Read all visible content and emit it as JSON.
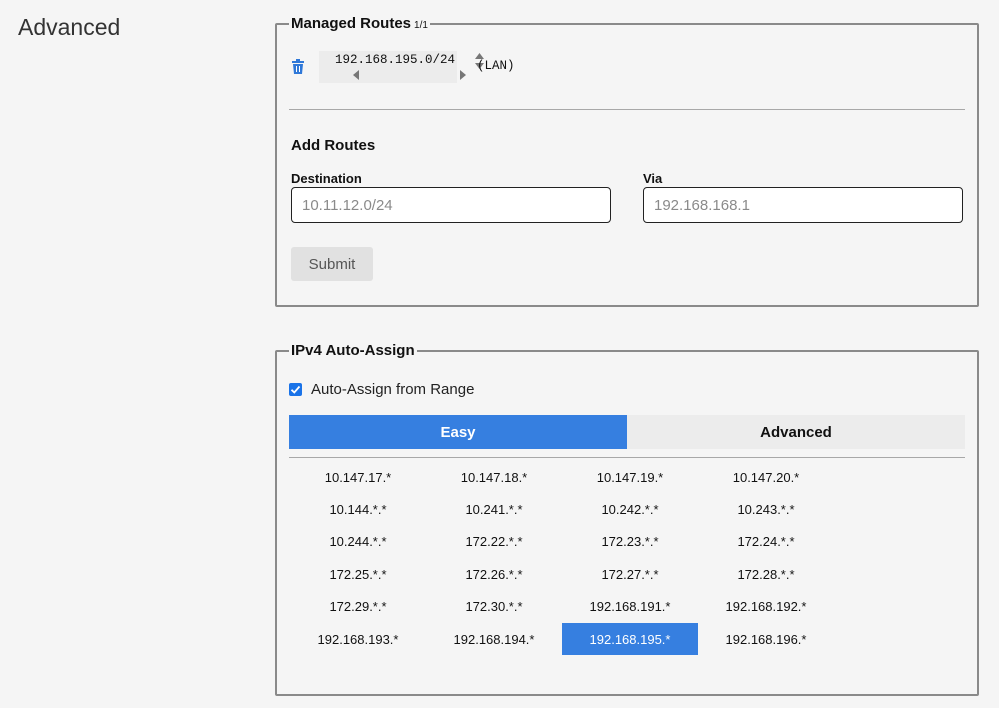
{
  "section_title": "Advanced",
  "managed_routes": {
    "legend": "Managed Routes",
    "count": "1/1",
    "routes": [
      {
        "target": "192.168.195.0/24",
        "via_label": "(LAN)"
      }
    ]
  },
  "add_routes": {
    "title": "Add Routes",
    "destination_label": "Destination",
    "destination_placeholder": "10.11.12.0/24",
    "via_label": "Via",
    "via_placeholder": "192.168.168.1",
    "submit_label": "Submit"
  },
  "ipv4": {
    "legend": "IPv4 Auto-Assign",
    "checkbox_label": "Auto-Assign from Range",
    "checkbox_checked": true,
    "tabs": [
      {
        "label": "Easy",
        "active": true
      },
      {
        "label": "Advanced",
        "active": false
      }
    ],
    "ranges": [
      "10.147.17.*",
      "10.147.18.*",
      "10.147.19.*",
      "10.147.20.*",
      "10.144.*.*",
      "10.241.*.*",
      "10.242.*.*",
      "10.243.*.*",
      "10.244.*.*",
      "172.22.*.*",
      "172.23.*.*",
      "172.24.*.*",
      "172.25.*.*",
      "172.26.*.*",
      "172.27.*.*",
      "172.28.*.*",
      "172.29.*.*",
      "172.30.*.*",
      "192.168.191.*",
      "192.168.192.*",
      "192.168.193.*",
      "192.168.194.*",
      "192.168.195.*",
      "192.168.196.*"
    ],
    "selected_range": "192.168.195.*"
  },
  "colors": {
    "accent": "#367fe0",
    "border": "#8a8a8a",
    "background": "#f5f5f5"
  }
}
